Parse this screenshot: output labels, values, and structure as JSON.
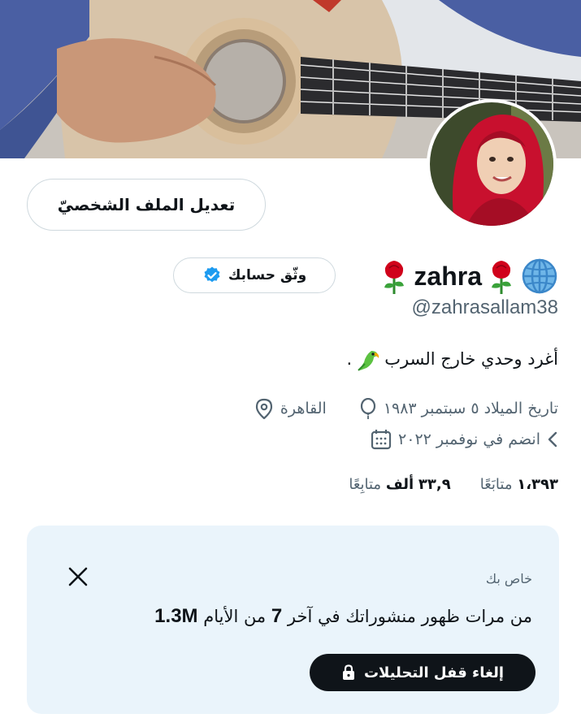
{
  "banner": {
    "image": "guitar-photo"
  },
  "avatar": {
    "image": "profile-photo"
  },
  "profile": {
    "edit_label": "تعديل الملف الشخصيّ",
    "verify_label": "وثّق حسابك",
    "name": "zahra",
    "handle": "@zahrasallam38",
    "bio": "أغرد وحدي خارج السرب",
    "bio_tail": ".",
    "birthday": "تاريخ الميلاد ٥ سبتمبر ١٩٨٣",
    "location": "القاهرة",
    "joined": "انضم في نوفمبر ٢٠٢٢"
  },
  "stats": {
    "following_count": "١،٣٩٣",
    "following_label": "متابَعًا",
    "followers_count": "٣٣,٩",
    "followers_unit": "ألف",
    "followers_label": "متابِعًا"
  },
  "analytics": {
    "private_label": "خاص بك",
    "text_prefix": "من مرات ظهور منشوراتك في آخر",
    "days": "7",
    "text_suffix": "من الأيام",
    "impressions": "1.3M",
    "unlock_label": "إلغاء قفل التحليلات"
  },
  "colors": {
    "verified_blue": "#1d9bf0",
    "rose_red": "#d0021b",
    "card_bg": "#eaf4fb",
    "button_dark": "#0f1419"
  }
}
